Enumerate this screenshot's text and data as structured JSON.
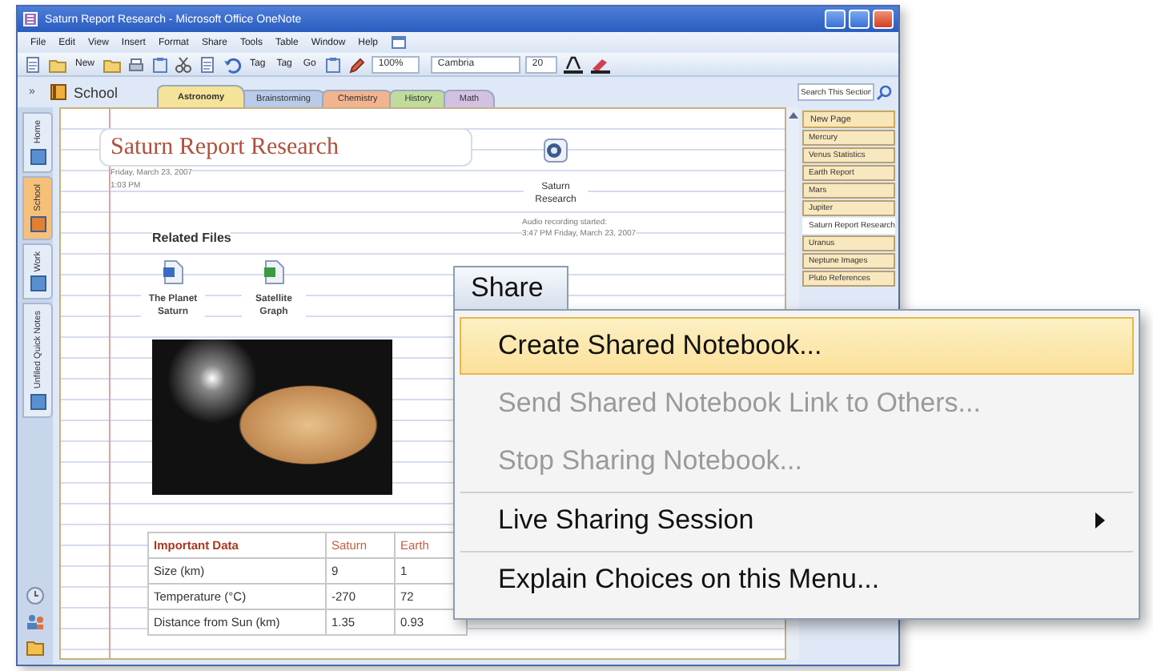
{
  "window": {
    "title": "Saturn Report Research - Microsoft Office OneNote"
  },
  "menu_bar": [
    "File",
    "Edit",
    "View",
    "Insert",
    "Format",
    "Share",
    "Tools",
    "Table",
    "Window",
    "Help"
  ],
  "toolbar": {
    "new_button": "New",
    "tag_button": "Tag",
    "todo_button": "Tag",
    "go_button": "Go",
    "zoom": "100%",
    "font": "Cambria",
    "font_size": "20"
  },
  "collapse_button": "»",
  "notebook": "School",
  "section_tabs": [
    {
      "label": "Astronomy",
      "selected": true,
      "color": "#f6e39a"
    },
    {
      "label": "Brainstorming",
      "selected": false,
      "color": "#b9cbe8"
    },
    {
      "label": "Chemistry",
      "selected": false,
      "color": "#f2b48e"
    },
    {
      "label": "History",
      "selected": false,
      "color": "#bfdc9c"
    },
    {
      "label": "Math",
      "selected": false,
      "color": "#d3c1e3"
    }
  ],
  "search": {
    "placeholder": "Search This Section"
  },
  "navigation": [
    {
      "label": "Home",
      "selected": false
    },
    {
      "label": "School",
      "selected": true
    },
    {
      "label": "Work",
      "selected": false
    },
    {
      "label": "Unfiled Quick Notes",
      "selected": false
    }
  ],
  "pages": {
    "new_page": "New Page",
    "items": [
      {
        "label": "Mercury",
        "selected": false
      },
      {
        "label": "Venus Statistics",
        "selected": false
      },
      {
        "label": "Earth Report",
        "selected": false
      },
      {
        "label": "Mars",
        "selected": false
      },
      {
        "label": "Jupiter",
        "selected": false
      },
      {
        "label": "Saturn Report Research",
        "selected": true
      },
      {
        "label": "Uranus",
        "selected": false
      },
      {
        "label": "Neptune Images",
        "selected": false
      },
      {
        "label": "Pluto References",
        "selected": false
      }
    ]
  },
  "page": {
    "title": "Saturn Report Research",
    "date": "Friday, March 23, 2007",
    "time": "1:03 PM",
    "audio": {
      "label": "Saturn Research",
      "note_lines": [
        "Audio recording started:",
        "3:47 PM Friday, March 23, 2007"
      ]
    },
    "related_files": {
      "heading": "Related Files",
      "files": [
        {
          "label": "The Planet Saturn",
          "kind": "word"
        },
        {
          "label": "Satellite Graph",
          "kind": "excel"
        }
      ]
    },
    "table": {
      "columns": [
        "Important Data",
        "Saturn",
        "Earth"
      ],
      "rows": [
        [
          "Size (km)",
          "9",
          "1"
        ],
        [
          "Temperature (°C)",
          "-270",
          "72"
        ],
        [
          "Distance from Sun (km)",
          "1.35",
          "0.93"
        ]
      ]
    }
  },
  "share_menu": {
    "title": "Share",
    "items": [
      {
        "label": "Create Shared Notebook...",
        "highlighted": true,
        "disabled": false,
        "submenu": false
      },
      {
        "label": "Send Shared Notebook Link to Others...",
        "highlighted": false,
        "disabled": true,
        "submenu": false
      },
      {
        "label": "Stop Sharing Notebook...",
        "highlighted": false,
        "disabled": true,
        "submenu": false
      },
      {
        "label": "Live Sharing Session",
        "highlighted": false,
        "disabled": false,
        "submenu": true
      },
      {
        "label": "Explain Choices on this Menu...",
        "highlighted": false,
        "disabled": false,
        "submenu": false
      }
    ]
  }
}
